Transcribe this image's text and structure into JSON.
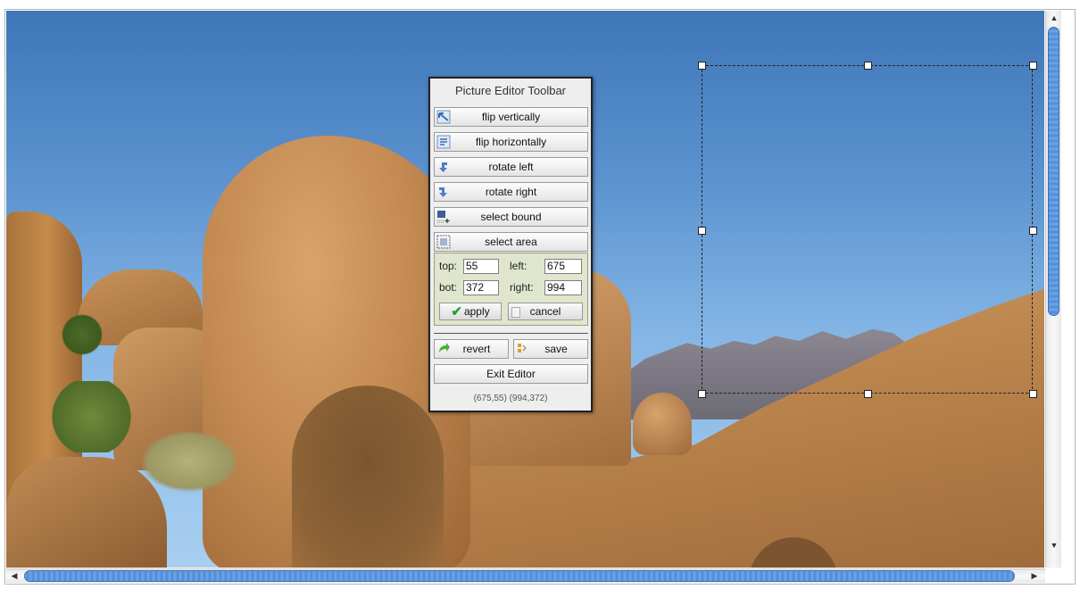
{
  "toolbar": {
    "title": "Picture Editor Toolbar",
    "buttons": {
      "flip_vertically": "flip vertically",
      "flip_horizontally": "flip horizontally",
      "rotate_left": "rotate left",
      "rotate_right": "rotate right",
      "select_bound": "select bound",
      "select_area": "select area",
      "revert": "revert",
      "save": "save",
      "exit": "Exit Editor"
    },
    "area": {
      "top_label": "top:",
      "top_value": "55",
      "left_label": "left:",
      "left_value": "675",
      "bot_label": "bot:",
      "bot_value": "372",
      "right_label": "right:",
      "right_value": "994",
      "apply_label": "apply",
      "cancel_label": "cancel"
    },
    "coords_readout": "(675,55) (994,372)"
  },
  "icons": {
    "flip_vertically": "flip-vertical-icon",
    "flip_horizontally": "flip-horizontal-icon",
    "rotate_left": "rotate-left-icon",
    "rotate_right": "rotate-right-icon",
    "select_bound": "select-bound-icon",
    "select_area": "select-area-icon",
    "apply": "checkmark-icon",
    "cancel": "cancel-icon",
    "revert": "revert-arrow-icon",
    "save": "save-icon"
  },
  "scroll_arrows": {
    "up": "▲",
    "down": "▼",
    "left": "◀",
    "right": "▶"
  },
  "colors": {
    "selection_border": "#222222",
    "scroll_thumb": "#5b95dd",
    "area_panel": "#dfe6cd"
  }
}
